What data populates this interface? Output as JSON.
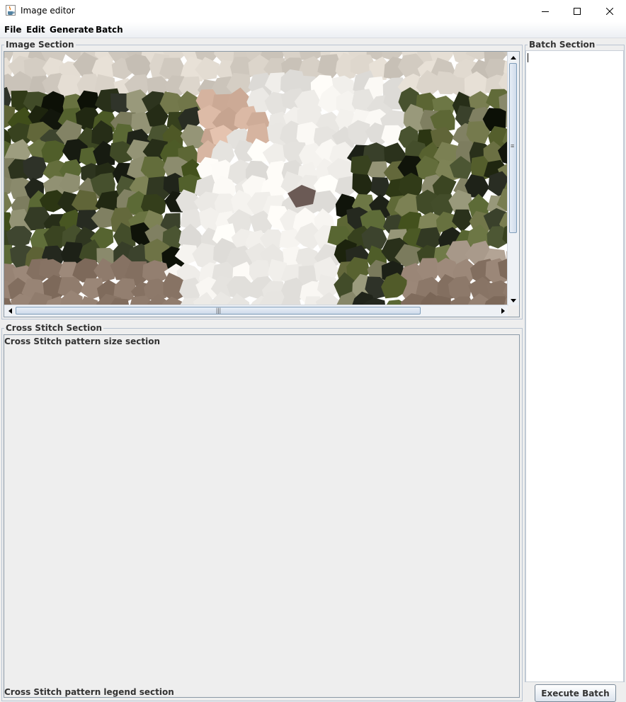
{
  "window": {
    "title": "Image editor",
    "icon": "java-cup-icon",
    "controls": [
      "minimize-icon",
      "maximize-icon",
      "close-icon"
    ]
  },
  "menu": {
    "items": [
      "File",
      "Edit",
      "Generate",
      "Batch"
    ]
  },
  "image_section": {
    "title": "Image Section",
    "image": "mosaic-photo",
    "vertical_scroll_fraction": 0.0,
    "horizontal_scroll_fraction": 0.0
  },
  "cross_stitch_section": {
    "title": "Cross Stitch Section",
    "size_label": "Cross Stitch pattern size section",
    "legend_label": "Cross Stitch pattern legend section"
  },
  "batch_section": {
    "title": "Batch Section",
    "text": "",
    "execute_label": "Execute Batch"
  },
  "colors": {
    "panel_border": "#b9c4d2",
    "background": "#eeeeee",
    "scroll_thumb": "#cfdbea"
  }
}
